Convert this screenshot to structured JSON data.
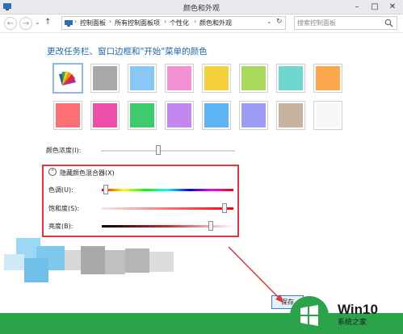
{
  "window": {
    "title": "颜色和外观",
    "min": "–",
    "max": "□",
    "close": "✕"
  },
  "nav": {
    "back": "←",
    "forward": "→",
    "dropdown": "⌄",
    "up": "↑",
    "refresh": "↻"
  },
  "address": {
    "crumbs": [
      "控制面板",
      "所有控制面板项",
      "个性化",
      "颜色和外观"
    ],
    "sep": "›"
  },
  "search": {
    "placeholder": "搜索控制面板"
  },
  "heading": "更改任务栏、窗口边框和\"开始\"菜单的颜色",
  "swatches": {
    "row1": [
      "auto",
      "#a8a8a8",
      "#88c8f4",
      "#f191d4",
      "#f3d03c",
      "#a8d85c",
      "#6fd6d0",
      "#fba64a"
    ],
    "row2": [
      "#fc6f72",
      "#ee4fa8",
      "#3ecb6e",
      "#c487ef",
      "#5db4f5",
      "#9d9df5",
      "#c8b39e",
      "#f8f8f8"
    ]
  },
  "intensity": {
    "label": "颜色浓度(I):",
    "level": 0.43
  },
  "mixer": {
    "toggle_icon": "⌃",
    "title": "隐藏颜色混合器(X)",
    "hue_label": "色调(U):",
    "hue_level": 0.03,
    "saturation_label": "饱和度(S):",
    "saturation_level": 0.93,
    "brightness_label": "亮度(B):",
    "brightness_level": 0.83
  },
  "save_button": {
    "label": "保存"
  },
  "watermark": {
    "brand": "Win10",
    "sub": "系统之家"
  }
}
